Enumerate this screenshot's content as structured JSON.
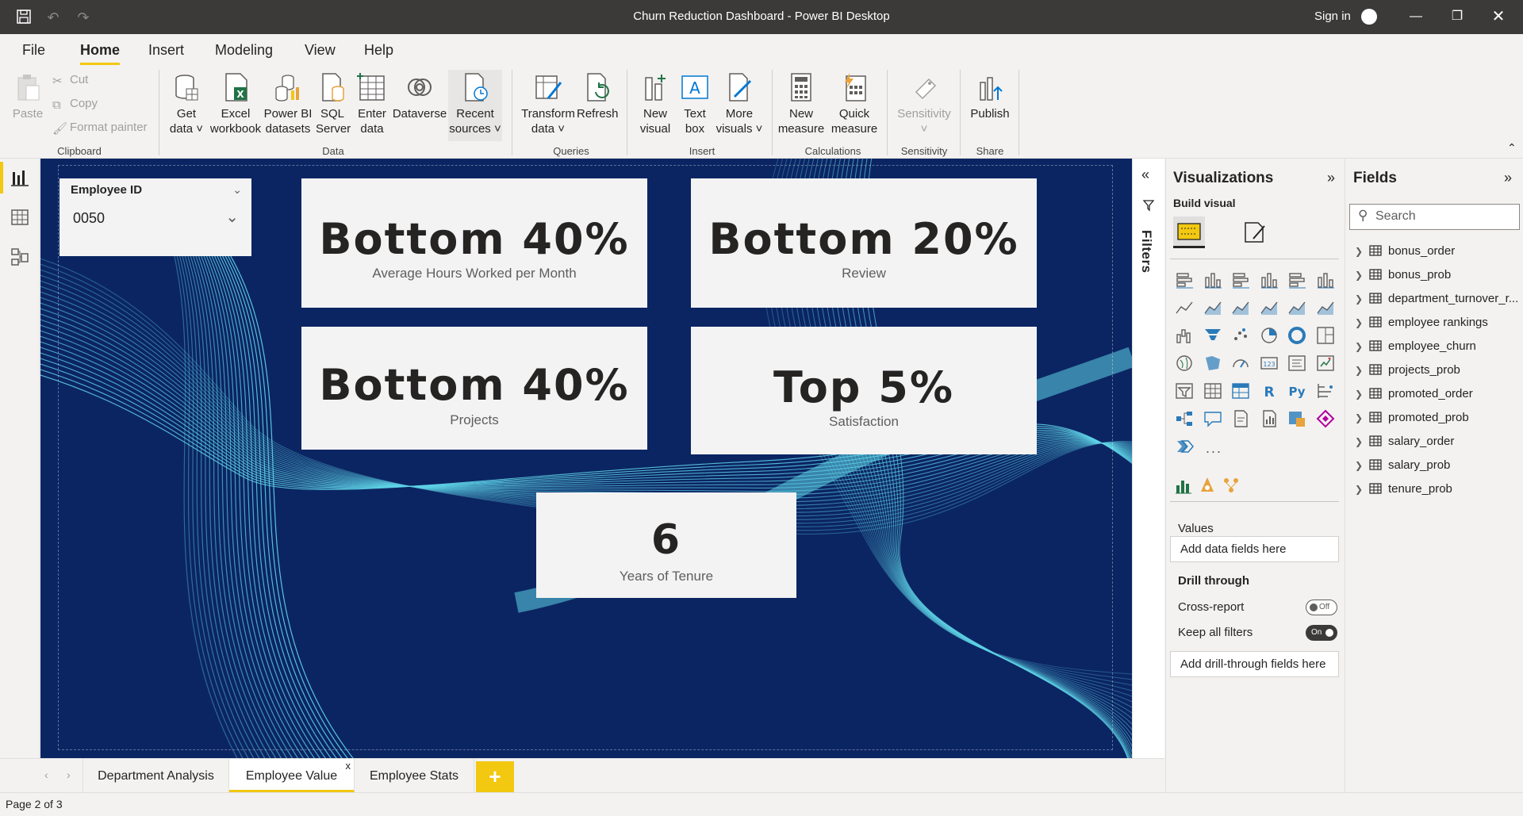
{
  "titlebar": {
    "title": "Churn Reduction Dashboard - Power BI Desktop",
    "sign_in": "Sign in"
  },
  "menu": {
    "tabs": [
      "File",
      "Home",
      "Insert",
      "Modeling",
      "View",
      "Help"
    ],
    "active": "Home"
  },
  "ribbon": {
    "clipboard": {
      "paste": "Paste",
      "cut": "Cut",
      "copy": "Copy",
      "format_painter": "Format painter",
      "group": "Clipboard"
    },
    "data": {
      "get_data": [
        "Get",
        "data"
      ],
      "excel": [
        "Excel",
        "workbook"
      ],
      "pbi_datasets": [
        "Power BI",
        "datasets"
      ],
      "sql": [
        "SQL",
        "Server"
      ],
      "enter": [
        "Enter",
        "data"
      ],
      "dataverse": [
        "Dataverse",
        ""
      ],
      "recent": [
        "Recent",
        "sources"
      ],
      "group": "Data"
    },
    "queries": {
      "transform": [
        "Transform",
        "data"
      ],
      "refresh": "Refresh",
      "group": "Queries"
    },
    "insert": {
      "new_visual": [
        "New",
        "visual"
      ],
      "text_box": [
        "Text",
        "box"
      ],
      "more_visuals": [
        "More",
        "visuals"
      ],
      "group": "Insert"
    },
    "calculations": {
      "new_measure": [
        "New",
        "measure"
      ],
      "quick_measure": [
        "Quick",
        "measure"
      ],
      "group": "Calculations"
    },
    "sensitivity": {
      "label": "Sensitivity",
      "group": "Sensitivity"
    },
    "share": {
      "publish": "Publish",
      "group": "Share"
    }
  },
  "canvas": {
    "slicer": {
      "header": "Employee ID",
      "value": "0050"
    },
    "cards": [
      {
        "value": "Bottom 40%",
        "label": "Average Hours Worked per Month"
      },
      {
        "value": "Bottom 20%",
        "label": "Review"
      },
      {
        "value": "Bottom 40%",
        "label": "Projects"
      },
      {
        "value": "Top 5%",
        "label": "Satisfaction"
      },
      {
        "value": "6",
        "label": "Years of Tenure"
      }
    ]
  },
  "page_tabs": {
    "tabs": [
      "Department Analysis",
      "Employee Value",
      "Employee Stats"
    ],
    "active": "Employee Value",
    "close": "x",
    "add": "+"
  },
  "status": {
    "page": "Page 2 of 3"
  },
  "filters_pane": {
    "label": "Filters"
  },
  "visualizations": {
    "title": "Visualizations",
    "build_visual": "Build visual",
    "values_label": "Values",
    "values_placeholder": "Add data fields here",
    "drill_through": "Drill through",
    "cross_report": "Cross-report",
    "cross_report_state": "Off",
    "keep_all_filters": "Keep all filters",
    "keep_all_filters_state": "On",
    "drill_placeholder": "Add drill-through fields here",
    "more": "..."
  },
  "fields": {
    "title": "Fields",
    "search_placeholder": "Search",
    "tables": [
      "bonus_order",
      "bonus_prob",
      "department_turnover_r...",
      "employee rankings",
      "employee_churn",
      "projects_prob",
      "promoted_order",
      "promoted_prob",
      "salary_order",
      "salary_prob",
      "tenure_prob"
    ]
  },
  "colors": {
    "accent": "#f2c811",
    "canvas_bg": "#0b2563",
    "wave": "#5fd3e6",
    "titlebar": "#3b3a39"
  }
}
